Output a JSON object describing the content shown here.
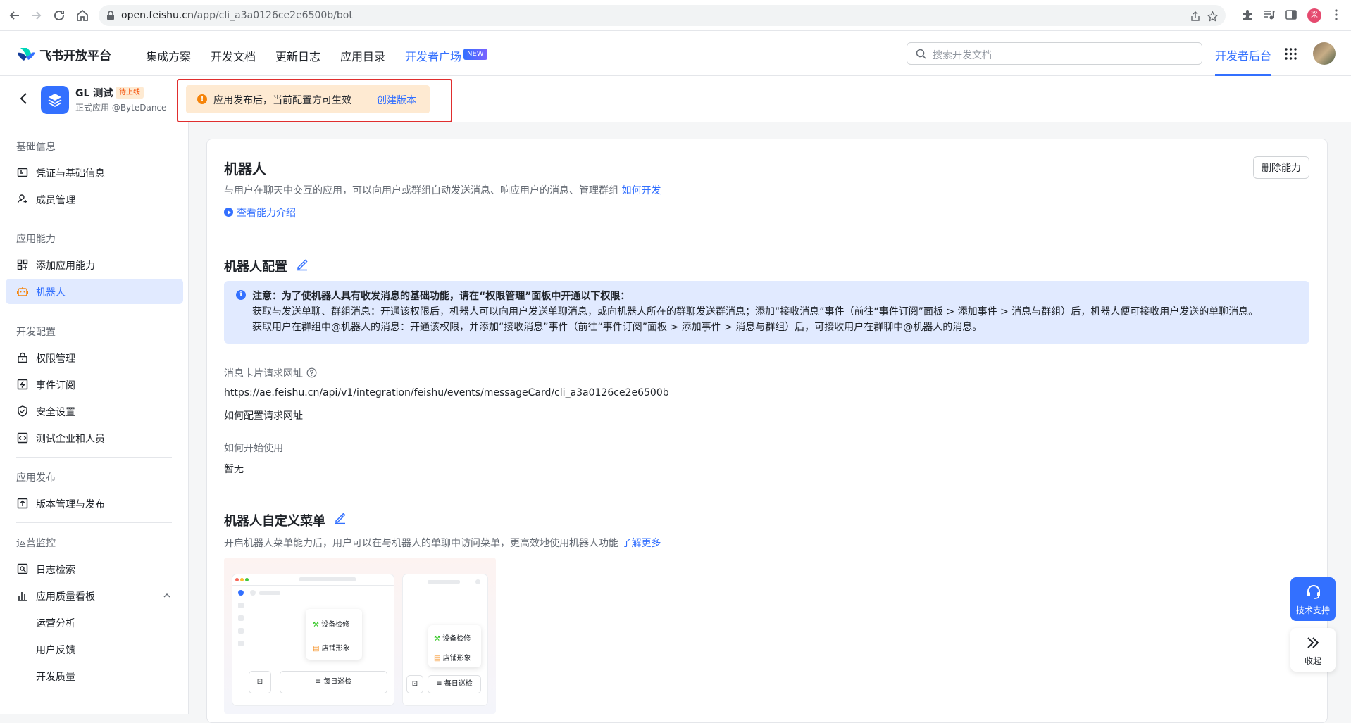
{
  "browser": {
    "url_host": "open.feishu.cn",
    "url_path": "/app/cli_a3a0126ce2e6500b/bot",
    "profile_initial": "梁"
  },
  "topnav": {
    "brand": "飞书开放平台",
    "items": [
      "集成方案",
      "开发文档",
      "更新日志",
      "应用目录"
    ],
    "plaza": "开发者广场",
    "new_badge": "NEW",
    "search_placeholder": "搜索开发文档",
    "dev_console": "开发者后台"
  },
  "app": {
    "name": "GL 测试",
    "status": "待上线",
    "subtitle": "正式应用 @ByteDance"
  },
  "notice": {
    "text": "应用发布后，当前配置方可生效",
    "link": "创建版本"
  },
  "sidebar": {
    "groups": [
      {
        "title": "基础信息",
        "items": [
          {
            "label": "凭证与基础信息",
            "icon": "id-card-icon"
          },
          {
            "label": "成员管理",
            "icon": "add-member-icon"
          }
        ]
      },
      {
        "title": "应用能力",
        "items": [
          {
            "label": "添加应用能力",
            "icon": "grid-add-icon"
          },
          {
            "label": "机器人",
            "icon": "robot-icon",
            "active": true
          }
        ]
      },
      {
        "title": "开发配置",
        "items": [
          {
            "label": "权限管理",
            "icon": "lock-icon"
          },
          {
            "label": "事件订阅",
            "icon": "event-icon"
          },
          {
            "label": "安全设置",
            "icon": "shield-icon"
          },
          {
            "label": "测试企业和人员",
            "icon": "code-icon"
          }
        ]
      },
      {
        "title": "应用发布",
        "items": [
          {
            "label": "版本管理与发布",
            "icon": "upload-icon"
          }
        ]
      },
      {
        "title": "运营监控",
        "items": [
          {
            "label": "日志检索",
            "icon": "log-search-icon"
          },
          {
            "label": "应用质量看板",
            "icon": "bar-chart-icon",
            "expanded": true
          },
          {
            "label": "运营分析"
          },
          {
            "label": "用户反馈"
          },
          {
            "label": "开发质量"
          }
        ]
      }
    ]
  },
  "main": {
    "title": "机器人",
    "desc": "与用户在聊天中交互的应用，可以向用户或群组自动发送消息、响应用户的消息、管理群组",
    "desc_link": "如何开发",
    "intro_link": "查看能力介绍",
    "delete_button": "删除能力",
    "config": {
      "title": "机器人配置",
      "info_title": "注意：为了使机器人具有收发消息的基础功能，请在“权限管理”面板中开通以下权限：",
      "info_line1": "获取与发送单聊、群组消息：开通该权限后，机器人可以向用户发送单聊消息，或向机器人所在的群聊发送群消息；添加“接收消息”事件（前往“事件订阅”面板 > 添加事件 > 消息与群组）后，机器人便可接收用户发送的单聊消息。",
      "info_line2": "获取用户在群组中@机器人的消息：开通该权限，并添加“接收消息”事件（前往“事件订阅”面板 > 添加事件 > 消息与群组）后，可接收用户在群聊中@机器人的消息。",
      "card_url_label": "消息卡片请求网址",
      "card_url": "https://ae.feishu.cn/api/v1/integration/feishu/events/messageCard/cli_a3a0126ce2e6500b",
      "card_url_help": "如何配置请求网址",
      "getting_started_label": "如何开始使用",
      "getting_started_value": "暂无"
    },
    "menu": {
      "title": "机器人自定义菜单",
      "desc": "开启机器人菜单能力后，用户可以在与机器人的单聊中访问菜单，更高效地使用机器人功能",
      "desc_link": "了解更多",
      "illus_item1": "设备检修",
      "illus_item2": "店铺形象",
      "illus_bar": "每日巡检"
    }
  },
  "floating": {
    "support": "技术支持",
    "collapse": "收起"
  },
  "colors": {
    "accent": "#3370ff",
    "warning_bg": "#feead2",
    "info_bg": "#e1eaff",
    "highlight_border": "#e02e2e"
  }
}
